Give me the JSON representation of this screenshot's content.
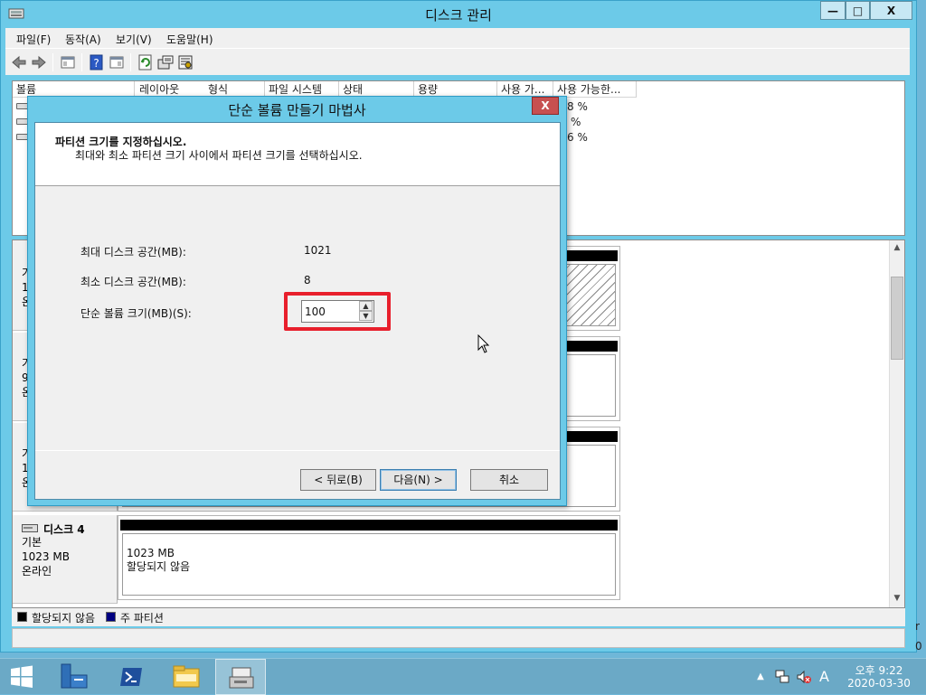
{
  "window": {
    "title": "디스크 관리",
    "controls": {
      "minimize": "—",
      "maximize": "□",
      "close": "X"
    }
  },
  "menu": [
    "파일(F)",
    "동작(A)",
    "보기(V)",
    "도움말(H)"
  ],
  "volume_list": {
    "columns": [
      "볼륨",
      "레이아웃",
      "형식",
      "파일 시스템",
      "상태",
      "용량",
      "사용 가...",
      "사용 가능한..."
    ],
    "rows_visible_tail": [
      "8 %",
      "%",
      "6 %"
    ]
  },
  "disks": [
    {
      "label": "디스크 4",
      "type": "기본",
      "size": "1023 MB",
      "status": "온라인",
      "partition": {
        "size": "1023 MB",
        "status": "할당되지 않음"
      }
    }
  ],
  "partial_disk_label_chars": [
    [
      "가",
      "1",
      "온"
    ],
    [
      "가",
      "9",
      "온"
    ],
    [
      "가",
      "1",
      "온"
    ]
  ],
  "legend": [
    {
      "label": "할당되지 않음",
      "color": "#000000"
    },
    {
      "label": "주 파티션",
      "color": "#000080"
    }
  ],
  "dialog": {
    "title": "단순 볼륨 만들기 마법사",
    "close": "X",
    "heading": "파티션 크기를 지정하십시오.",
    "subheading": "최대와 최소 파티션 크기 사이에서 파티션 크기를 선택하십시오.",
    "max_label": "최대 디스크 공간(MB):",
    "max_value": "1021",
    "min_label": "최소 디스크 공간(MB):",
    "min_value": "8",
    "size_label": "단순 볼륨 크기(MB)(S):",
    "size_value": "100",
    "buttons": {
      "back": "< 뒤로(B)",
      "next": "다음(N) >",
      "cancel": "취소"
    }
  },
  "taskbar": {
    "clock_time": "오후 9:22",
    "clock_date": "2020-03-30",
    "ime": "A"
  },
  "edge_fragments": [
    "r",
    "0"
  ]
}
